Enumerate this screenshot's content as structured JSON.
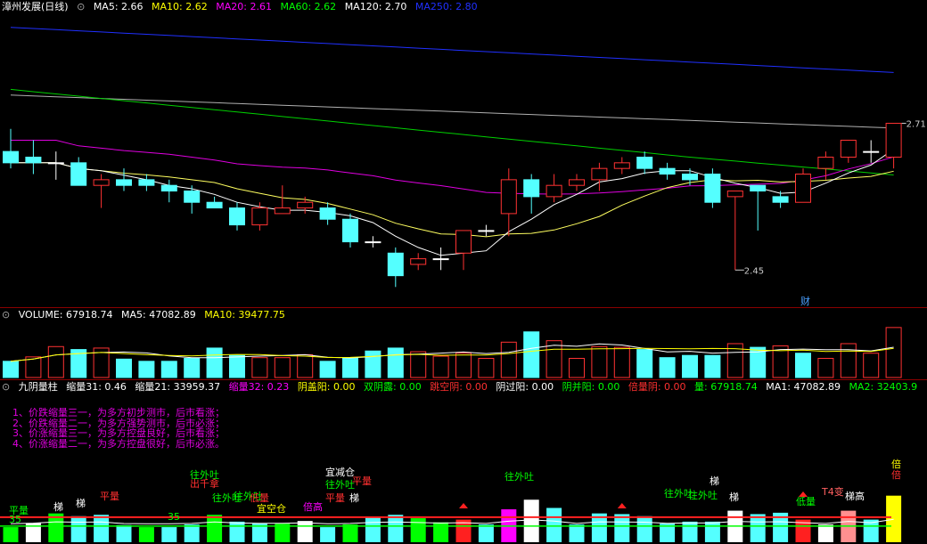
{
  "main_header": {
    "title": "漳州发展(日线)",
    "ma": [
      {
        "label": "MA5: 2.66",
        "color": "#ffffff"
      },
      {
        "label": "MA10: 2.62",
        "color": "#ffff00"
      },
      {
        "label": "MA20: 2.61",
        "color": "#ff00ff"
      },
      {
        "label": "MA60: 2.62",
        "color": "#00ff00"
      },
      {
        "label": "MA120: 2.70",
        "color": "#ffffff"
      },
      {
        "label": "MA250: 2.80",
        "color": "#0000ff"
      }
    ]
  },
  "price_labels": {
    "high": "2.71",
    "low": "2.45",
    "finance_tag": "财"
  },
  "volume_header": {
    "items": [
      {
        "label": "VOLUME: 67918.74",
        "color": "#ffffff"
      },
      {
        "label": "MA5: 47082.89",
        "color": "#ffffff"
      },
      {
        "label": "MA10: 39477.75",
        "color": "#ffff00"
      }
    ]
  },
  "indicator_header": {
    "items": [
      {
        "label": "九阴量柱",
        "color": "#ffffff"
      },
      {
        "label": "缩量31: 0.46",
        "color": "#ffffff"
      },
      {
        "label": "缩量21: 33959.37",
        "color": "#ffffff"
      },
      {
        "label": "缩量32: 0.23",
        "color": "#ff00ff"
      },
      {
        "label": "阴盖阳: 0.00",
        "color": "#ffff00"
      },
      {
        "label": "双阴露: 0.00",
        "color": "#00ff00"
      },
      {
        "label": "跳空阴: 0.00",
        "color": "#ff3030"
      },
      {
        "label": "阴过阳: 0.00",
        "color": "#ffffff"
      },
      {
        "label": "阴并阳: 0.00",
        "color": "#00ff00"
      },
      {
        "label": "倍量阴: 0.00",
        "color": "#ff3030"
      },
      {
        "label": "量: 67918.74",
        "color": "#00ff00"
      },
      {
        "label": "MA1: 47082.89",
        "color": "#ffffff"
      },
      {
        "label": "MA2: 32403.9",
        "color": "#00ff00"
      }
    ]
  },
  "notes": [
    "1、价跌缩量三一，为多方初步测市，后市看涨；",
    "2、价跌缩量二一，为多方强势测市，后市必涨；",
    "3、价涨缩量三一，为多方控盘良好，后市看涨；",
    "4、价涨缩量二一，为多方控盘很好，后市必涨。"
  ],
  "signals": [
    {
      "text": "梯",
      "color": "#ffffff"
    },
    {
      "text": "梯",
      "color": "#ffffff"
    },
    {
      "text": "平量",
      "color": "#ff3030"
    },
    {
      "text": "往外吐",
      "color": "#00ff00"
    },
    {
      "text": "出千拿",
      "color": "#ff3030"
    },
    {
      "text": "往外吐",
      "color": "#00ff00"
    },
    {
      "text": "往外吐",
      "color": "#00ff00"
    },
    {
      "text": "低量",
      "color": "#ff3030"
    },
    {
      "text": "宜空仓",
      "color": "#ffff00"
    },
    {
      "text": "宜减仓",
      "color": "#ffffff"
    },
    {
      "text": "往外吐",
      "color": "#00ff00"
    },
    {
      "text": "平量",
      "color": "#ff3030"
    },
    {
      "text": "平量",
      "color": "#ff3030"
    },
    {
      "text": "梯",
      "color": "#ffffff"
    },
    {
      "text": "倍高",
      "color": "#ff00ff"
    },
    {
      "text": "往外吐",
      "color": "#00ff00"
    },
    {
      "text": "往外吐",
      "color": "#00ff00"
    },
    {
      "text": "往外吐",
      "color": "#00ff00"
    },
    {
      "text": "梯",
      "color": "#ffffff"
    },
    {
      "text": "梯",
      "color": "#ffffff"
    },
    {
      "text": "T4变",
      "color": "#ff6060"
    },
    {
      "text": "梯高",
      "color": "#ffffff"
    },
    {
      "text": "倍",
      "color": "#ffff00"
    },
    {
      "text": "倍",
      "color": "#ff3030"
    },
    {
      "text": "平量",
      "color": "#00ff00"
    },
    {
      "text": "低量",
      "color": "#00ff00"
    },
    {
      "text": "35",
      "color": "#00ff00"
    },
    {
      "text": "35",
      "color": "#00ff00"
    }
  ],
  "chart_data": [
    {
      "type": "candlestick",
      "title": "漳州发展(日线)",
      "ylim": [
        2.4,
        2.9
      ],
      "candles": [
        {
          "o": 2.66,
          "h": 2.7,
          "l": 2.63,
          "c": 2.64
        },
        {
          "o": 2.65,
          "h": 2.68,
          "l": 2.62,
          "c": 2.64
        },
        {
          "o": 2.64,
          "h": 2.66,
          "l": 2.61,
          "c": 2.64
        },
        {
          "o": 2.64,
          "h": 2.65,
          "l": 2.6,
          "c": 2.6
        },
        {
          "o": 2.6,
          "h": 2.62,
          "l": 2.56,
          "c": 2.61
        },
        {
          "o": 2.61,
          "h": 2.63,
          "l": 2.59,
          "c": 2.6
        },
        {
          "o": 2.61,
          "h": 2.62,
          "l": 2.59,
          "c": 2.6
        },
        {
          "o": 2.6,
          "h": 2.61,
          "l": 2.57,
          "c": 2.59
        },
        {
          "o": 2.59,
          "h": 2.6,
          "l": 2.55,
          "c": 2.57
        },
        {
          "o": 2.57,
          "h": 2.58,
          "l": 2.56,
          "c": 2.56
        },
        {
          "o": 2.56,
          "h": 2.57,
          "l": 2.52,
          "c": 2.53
        },
        {
          "o": 2.53,
          "h": 2.57,
          "l": 2.52,
          "c": 2.56
        },
        {
          "o": 2.55,
          "h": 2.6,
          "l": 2.55,
          "c": 2.56
        },
        {
          "o": 2.56,
          "h": 2.58,
          "l": 2.55,
          "c": 2.57
        },
        {
          "o": 2.56,
          "h": 2.57,
          "l": 2.53,
          "c": 2.54
        },
        {
          "o": 2.54,
          "h": 2.55,
          "l": 2.49,
          "c": 2.5
        },
        {
          "o": 2.5,
          "h": 2.51,
          "l": 2.49,
          "c": 2.5
        },
        {
          "o": 2.48,
          "h": 2.49,
          "l": 2.42,
          "c": 2.44
        },
        {
          "o": 2.46,
          "h": 2.48,
          "l": 2.45,
          "c": 2.47
        },
        {
          "o": 2.47,
          "h": 2.49,
          "l": 2.45,
          "c": 2.47
        },
        {
          "o": 2.48,
          "h": 2.52,
          "l": 2.45,
          "c": 2.52
        },
        {
          "o": 2.52,
          "h": 2.53,
          "l": 2.51,
          "c": 2.52
        },
        {
          "o": 2.55,
          "h": 2.63,
          "l": 2.51,
          "c": 2.61
        },
        {
          "o": 2.61,
          "h": 2.62,
          "l": 2.55,
          "c": 2.58
        },
        {
          "o": 2.58,
          "h": 2.62,
          "l": 2.57,
          "c": 2.6
        },
        {
          "o": 2.6,
          "h": 2.62,
          "l": 2.59,
          "c": 2.61
        },
        {
          "o": 2.61,
          "h": 2.64,
          "l": 2.59,
          "c": 2.63
        },
        {
          "o": 2.63,
          "h": 2.65,
          "l": 2.62,
          "c": 2.64
        },
        {
          "o": 2.65,
          "h": 2.66,
          "l": 2.62,
          "c": 2.63
        },
        {
          "o": 2.63,
          "h": 2.64,
          "l": 2.61,
          "c": 2.62
        },
        {
          "o": 2.62,
          "h": 2.63,
          "l": 2.6,
          "c": 2.61
        },
        {
          "o": 2.62,
          "h": 2.63,
          "l": 2.56,
          "c": 2.57
        },
        {
          "o": 2.58,
          "h": 2.59,
          "l": 2.45,
          "c": 2.59
        },
        {
          "o": 2.6,
          "h": 2.6,
          "l": 2.52,
          "c": 2.59
        },
        {
          "o": 2.58,
          "h": 2.59,
          "l": 2.56,
          "c": 2.57
        },
        {
          "o": 2.57,
          "h": 2.63,
          "l": 2.57,
          "c": 2.62
        },
        {
          "o": 2.63,
          "h": 2.66,
          "l": 2.61,
          "c": 2.65
        },
        {
          "o": 2.65,
          "h": 2.68,
          "l": 2.64,
          "c": 2.68
        },
        {
          "o": 2.66,
          "h": 2.68,
          "l": 2.64,
          "c": 2.66
        },
        {
          "o": 2.65,
          "h": 2.71,
          "l": 2.63,
          "c": 2.71
        }
      ]
    },
    {
      "type": "bar",
      "title": "VOLUME",
      "ylim": [
        0,
        75000
      ],
      "values": [
        22000,
        28000,
        42000,
        38000,
        40000,
        25000,
        22000,
        22000,
        26000,
        40000,
        30000,
        27000,
        27000,
        31000,
        22000,
        26000,
        36000,
        40000,
        35000,
        29000,
        33000,
        26000,
        48000,
        62000,
        50000,
        26000,
        42000,
        41000,
        38000,
        27000,
        30000,
        30000,
        46000,
        41000,
        43000,
        33000,
        26000,
        46000,
        33000,
        67918.74
      ],
      "down": [
        true,
        false,
        false,
        true,
        false,
        true,
        true,
        true,
        true,
        true,
        true,
        false,
        false,
        false,
        true,
        true,
        true,
        true,
        false,
        false,
        false,
        false,
        false,
        true,
        false,
        false,
        false,
        false,
        true,
        true,
        true,
        true,
        false,
        true,
        false,
        true,
        false,
        false,
        false,
        false
      ]
    },
    {
      "type": "bar",
      "title": "九阴量柱",
      "ylim": [
        0,
        75000
      ],
      "values": [
        22000,
        28000,
        42000,
        38000,
        40000,
        25000,
        22000,
        22000,
        26000,
        40000,
        30000,
        27000,
        27000,
        31000,
        22000,
        26000,
        36000,
        40000,
        35000,
        29000,
        33000,
        26000,
        48000,
        62000,
        50000,
        26000,
        42000,
        41000,
        38000,
        27000,
        30000,
        30000,
        46000,
        41000,
        43000,
        33000,
        26000,
        46000,
        33000,
        67918.74
      ]
    }
  ]
}
